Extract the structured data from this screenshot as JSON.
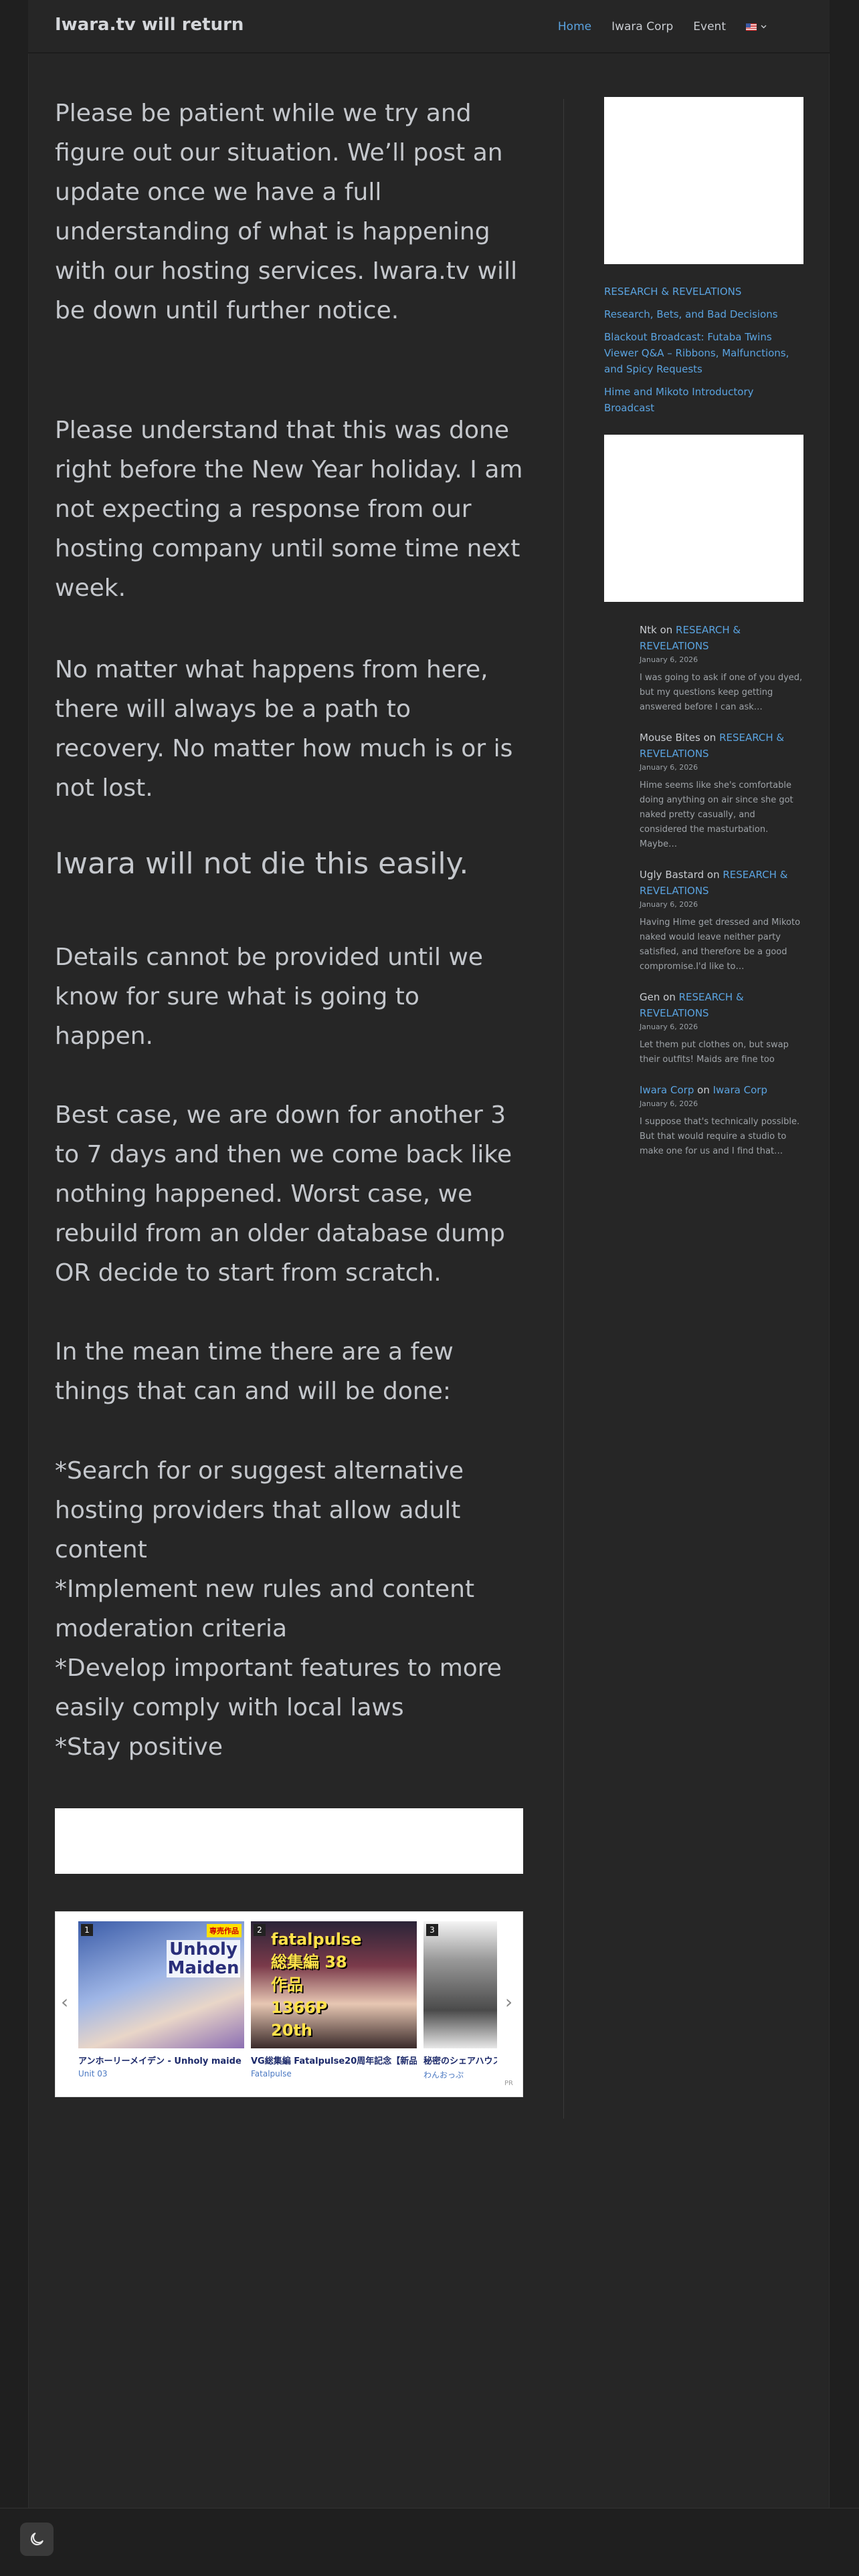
{
  "site": {
    "title": "Iwara.tv will return"
  },
  "nav": {
    "items": [
      {
        "label": "Home",
        "active": true
      },
      {
        "label": "Iwara Corp",
        "active": false
      },
      {
        "label": "Event",
        "active": false
      }
    ],
    "language_icon": "us-flag-icon"
  },
  "main": {
    "p1": "Please be patient while we try and figure out our situation. We’ll post an update once we have a full understanding of what is happening with our hosting services. Iwara.tv will be down until further notice.",
    "p2": "Please understand that this was done right before the New Year holiday. I am not expecting a response from our hosting company until some time next week.",
    "p3": "No matter what happens from here, there will always be a path to recovery. No matter how much is or is not lost.",
    "p4": "Iwara will not die this easily.",
    "p5": "Details cannot be provided until we know for sure what is going to happen.",
    "p6": "Best case, we are down for another 3 to 7 days and then we come back like nothing happened. Worst case, we rebuild from an older database dump OR decide to start from scratch.",
    "p7": "In the mean time there are a few things that can and will be done:",
    "list": [
      "*Search for or suggest alternative hosting providers that allow adult content",
      "*Implement new rules and content moderation criteria",
      "*Develop important features to more easily comply with local laws",
      "*Stay positive"
    ]
  },
  "carousel": {
    "items": [
      {
        "rank": "1",
        "title": "アンホーリーメイデン - Unholy maide",
        "sub": "Unit 03",
        "art_text": "Unholy Maiden",
        "badge": "専売作品"
      },
      {
        "rank": "2",
        "title": "VG総集編 Fatalpulse20周年記念【新品",
        "sub": "Fatalpulse",
        "art_text": "fatalpulse 総集編 38作品 1366P 20th",
        "badge": ""
      },
      {
        "rank": "3",
        "title": "秘密のシェアハウス",
        "sub": "わんおっぷ",
        "art_text": "",
        "badge": ""
      }
    ],
    "pr": "PR"
  },
  "sidebar": {
    "posts": [
      "RESEARCH & REVELATIONS",
      "Research, Bets, and Bad Decisions",
      "Blackout Broadcast: Futaba Twins Viewer Q&A – Ribbons, Malfunctions, and Spicy Requests",
      "Hime and Mikoto Introductory Broadcast"
    ],
    "comments": [
      {
        "author": "Ntk",
        "on": "on",
        "post": "RESEARCH & REVELATIONS",
        "author_link": false,
        "date": "January 6, 2026",
        "excerpt": "I was going to ask if one of you dyed, but my questions keep getting answered before I can ask…"
      },
      {
        "author": "Mouse Bites",
        "on": "on",
        "post": "RESEARCH & REVELATIONS",
        "author_link": false,
        "date": "January 6, 2026",
        "excerpt": "Hime seems like she's comfortable doing anything on air since she got naked pretty casually, and considered the masturbation. Maybe…"
      },
      {
        "author": "Ugly Bastard",
        "on": "on",
        "post": "RESEARCH & REVELATIONS",
        "author_link": false,
        "date": "January 6, 2026",
        "excerpt": "Having Hime get dressed and Mikoto naked would leave neither party satisfied, and therefore be a good compromise.I'd like to…"
      },
      {
        "author": "Gen",
        "on": "on",
        "post": "RESEARCH & REVELATIONS",
        "author_link": false,
        "date": "January 6, 2026",
        "excerpt": "Let them put clothes on, but swap their outfits! Maids are fine too"
      },
      {
        "author": "Iwara Corp",
        "on": "on",
        "post": "Iwara Corp",
        "author_link": true,
        "date": "January 6, 2026",
        "excerpt": "I suppose that's technically possible. But that would require a studio to make one for us and I find that…"
      }
    ]
  },
  "colors": {
    "link": "#5aa3e0",
    "bg": "#262626",
    "text": "#c4c7cc"
  },
  "footer": {
    "toggle_icon": "moon-icon"
  }
}
